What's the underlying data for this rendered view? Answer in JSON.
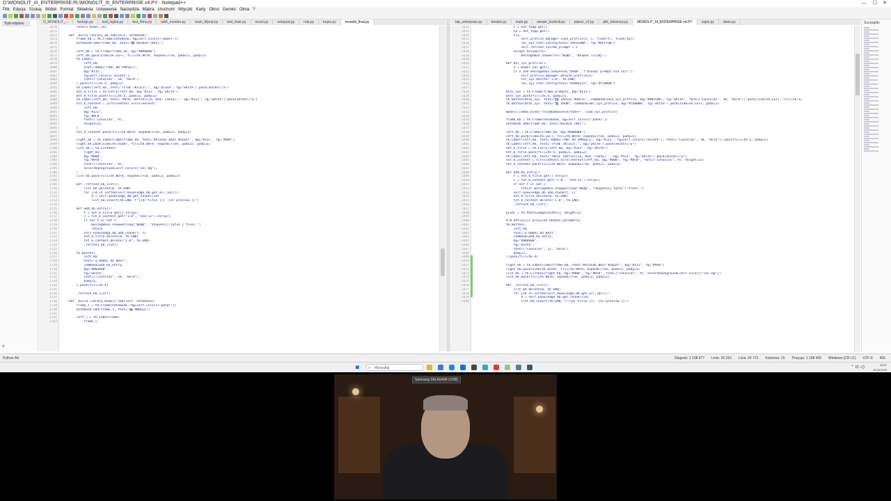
{
  "window": {
    "title": "D:\\MONOLIT_III_ENTERPRISE.PL\\MONOLIT_III_ENTERPRISE.v4.PY - Notepad++",
    "minimize": "—",
    "maximize": "☐",
    "close": "✕"
  },
  "menu": [
    "Plik",
    "Edycja",
    "Szukaj",
    "Widok",
    "Format",
    "Składnia",
    "Ustawienia",
    "Narzędzia",
    "Makra",
    "Uruchom",
    "Wtyczki",
    "Karty",
    "Okno",
    "Gemini",
    "Okna",
    "?"
  ],
  "left_tabs": [
    "D_MONOLIT_...",
    "funkcje.py",
    "kod_logika.py",
    "test_filmu.py",
    "tab5_monitor.py",
    "main_Mysql.py",
    "test_brak.py",
    "monit.py",
    "notepad.py",
    "rola.py",
    "kopia.py",
    "monolit_final.py"
  ],
  "right_tabs": [
    "tab_enterprise.py",
    "kreator.py",
    "main.py",
    "serwer_kontroli.py",
    "planer_v2.py",
    "plik_tekstowy.py",
    "MONOLIT_III_ENTERPRISE.v4.PY",
    "zapis.py",
    "dane.py"
  ],
  "left_panel": {
    "tab": "Tryb edytora",
    "gear": "⚙"
  },
  "right_panel": {
    "title": "Szczegóły"
  },
  "left_gutter_start": 2670,
  "right_gutter_start": 2412,
  "left_code": [
    "        return model_var",
    "",
    "    def _build_library_kb_tab(self, notebook):",
    "        frame_kb = tk.Frame(notebook, bg=self.colors[\"panel\"])",
    "        notebook.add(frame_kb, text=\"📚 WIEDZA (KAZ)\")",
    "",
    "        left_kb = tk.Frame(frame_kb, bg=\"#000000\")",
    "        left_kb.pack(side=tk.LEFT, fill=tk.BOTH, expand=True, padx=5, pady=5)",
    "        tk.Label(",
    "            left_kb,",
    "            text=\"DODAJ FAKT DO PAMIĘCI\",",
    "            bg=\"#111\",",
    "            fg=self.colors[\"accent\"],",
    "            font=(\"Consolas\", 10, \"bold\"),",
    "        ).pack(fill=tk.X, pady=5)",
    "        tk.Label(left_kb, text=\"TYTUŁ (Klucz):\", bg=\"black\", fg=\"white\").pack(anchor=\"w\")",
    "        ent_k_title = tk.Entry(left_kb, bg=\"#333\", fg=\"white\")",
    "        ent_k_title.pack(fill=tk.X, padx=5, pady=2)",
    "        tk.Label(left_kb, text=\"TREŚĆ (Definicja, Kod, Fakty):\", bg=\"#111\", fg=\"white\").pack(anchor=\"w\")",
    "        txt_k_content = scrolledtext.ScrolledText(",
    "            left_kb,",
    "            bg=\"#222\",",
    "            fg=\"#0F0\",",
    "            font=(\"Consolas\", 9),",
    "            height=15,",
    "        )",
    "        txt_k_content.pack(fill=tk.BOTH, expand=True, padx=5, pady=2)",
    "",
    "        right_kb = tk.LabelFrame(frame_kb, text=\"KATALOG BAZY WIEDZY\", bg=\"#111\", fg=\"#AAA\")",
    "        right_kb.pack(side=tk.RIGHT, fill=tk.BOTH, expand=True, padx=5, pady=5)",
    "        list_kb = tk.Listbox(",
    "            right_kb,",
    "            bg=\"#000\",",
    "            fg=\"#0f0\",",
    "            font=(\"Consolas\", 9),",
    "            selectbackground=self.colors[\"sel_bg\"],",
    "        )",
    "        list_kb.pack(fill=tk.BOTH, expand=True, padx=2, pady=2)",
    "",
    "        def _refresh_kb_list():",
    "            list_kb.delete(0, tk.END)",
    "            for cid in sorted(self.knowledge_db.get_all_ids()):",
    "                d = self.knowledge_db.get_chunk(cid)",
    "                list_kb.insert(tk.END, f\"[{d['title']}] :{d['preview']}\")",
    "",
    "        def add_kb_entry():",
    "            t = ent_k_title.get().strip()",
    "            c = txt_k_content.get(\"1.0\", \"end-1c\").strip()",
    "            if not t or not c:",
    "                messagebox.showwarning(\"BŁĄD\", \"Uzupełnij tytuł i treść.\")",
    "                return",
    "            self.knowledge_db.add_chunk(t, c)",
    "            ent_k_title.delete(0, tk.END)",
    "            txt_k_content.delete(\"1.0\", tk.END)",
    "            _refresh_kb_list()",
    "",
    "        tk.Button(",
    "            left_kb,",
    "            text=\"✚ DODAJ DO BAZY\",",
    "            command=add_kb_entry,",
    "            bg=\"#004400\",",
    "            fg=\"white\",",
    "            font=(\"Consolas\", 10, \"bold\"),",
    "            pady=5,",
    "        ).pack(fill=tk.X)",
    "",
    "        _refresh_kb_list()",
    "",
    "    def _build_library_models_tab(self, notebook):",
    "        frame_l = tk.Frame(notebook, bg=self.colors[\"panel\"])",
    "        notebook.add(frame_l, text=\"📦 MODELE\")",
    "",
    "        left_l = tk.LabelFrame(",
    "            frame_l,"
  ],
  "right_code": [
    "        t = ent_temp.get()",
    "        tp = ent_topp.get()",
    "        try:",
    "            self.profile_manager.save_profile(n, s, float(t), float(tp))",
    "            lbl_sys_stat.config(text=\"ZAPISANO\", fg=\"#0FFF00\")",
    "            self.refresh_system_prompt = s",
    "        except ValueError:",
    "            messagebox.showerror(\"BŁĄD\", \"Błędne liczby\")",
    "",
    "    def del_sys_profile():",
    "        n = model_var.get()",
    "        if n and messagebox.askyesno(\"USUŃ\", f\"Usunąć prompt dla {n}?\"):",
    "            self.profile_manager.delete_profile(n)",
    "            txt_sys.delete(\"1.0\", tk.END)",
    "            lbl_sys_stat.config(text=\"USUNIĘTO\", fg=\"#FF0000\")",
    "",
    "    btns_sys = tk.Frame(frame_prompts, bg=\"#111\")",
    "    btns_sys.pack(fill=tk.X, pady=5)",
    "    tk.Button(btns_sys, text=\"💾 ZAPISZ PROFIL\", command=save_sys_profile, bg=\"#005500\", fg=\"white\", font=(\"Consolas\", 10, \"bold\")).pack(side=tk.LEFT, fill=tk.X)",
    "    tk.Button(btns_sys, text=\"🗑 USUŃ\", command=del_sys_profile, bg=\"#550000\", fg=\"white\").pack(side=tk.LEFT, padx=2)",
    "",
    "    models_combo.bind(\"<<ComboboxSelected>>\", load_sys_profile)",
    "",
    "    frame_kb = tk.Frame(notebook, bg=self.colors[\"panel\"])",
    "    notebook.add(frame_kb, text=\"WIEDZA (KB)\")",
    "",
    "    left_kb = tk.Frame(frame_kb, bg=\"#000000\")",
    "    left_kb.pack(side=tk.LEFT, fill=tk.BOTH, expand=True, padx=5, pady=5)",
    "    tk.Label(left_kb, text=\"DODAJ FAKT DO PAMIĘCI\", bg=\"#111\", fg=self.colors[\"accent\"], font=(\"Consolas\", 10, \"bold\")).pack(fill=tk.X, pady=5)",
    "    tk.Label(left_kb, text=\"TYTUŁ (Klucz):\", bg=\"white\").pack(anchor=\"w\")",
    "    ent_k_title = tk.Entry(left_kb, bg=\"#333\", fg=\"white\")",
    "    ent_k_title.pack(fill=tk.X, padx=5, pady=2)",
    "    tk.Label(left_kb, text=\"TREŚĆ (Definicja, Kod, Fakty):\", bg=\"#111\", fg=\"white\").pack(anchor=\"w\")",
    "    txt_k_content = scrolledtext.ScrolledText(left_kb, bg=\"#000\", fg=\"#0F0\", font=(\"Consolas\", 9), height=15)",
    "    txt_k_content.pack(fill=tk.BOTH, expand=True, padx=5, pady=2)",
    "",
    "    def add_kb_entry():",
    "        t = ent_k_title.get().strip()",
    "        c = txt_k_content.get(\"1.0\", \"end-1c\").strip()",
    "        if not t or not c:",
    "            return messagebox.showwarning(\"BŁĄD\", \"Uzupełnij tytuł i treść.\")",
    "        self.knowledge_db.add_chunk(t, c)",
    "        ent_k_title.delete(0, tk.END)",
    "        txt_k_content.delete(\"1.0\", tk.END)",
    "        _refresh_kb_list()",
    "",
    "    pixel = tk.PhotoImage(width=1, height=1)",
    "",
    "    # W definicji przycisk dodano parametry:",
    "    tk.Button(",
    "        left_kb,",
    "        text=\"✚ DODAJ DO BAZY\",",
    "        command=add_kb_entry,",
    "        bg=\"#006600\",",
    "        fg=\"white\",",
    "        font=(\"Consolas\", 11, \"bold\"),",
    "        pady=5,",
    "    ).pack(fill=tk.X)",
    "",
    "    right_kb = tk.LabelFrame(frame_kb, text=\"KATALOG BAZY WIEDZY\", bg=\"#111\", fg=\"#AAA\")",
    "    right_kb.pack(side=tk.RIGHT, fill=tk.BOTH, expand=True, padx=5, pady=5)",
    "    list_kb = tk.Listbox(right_kb, bg=\"#000\", fg=\"#0f0\", font=(\"Consolas\", 9), selectbackground=self.colors[\"sel_bg\"])",
    "    list_kb.pack(fill=tk.BOTH, expand=True, padx=2, pady=2)",
    "",
    "    def _refresh_kb_list():",
    "        list_kb.delete(0, tk.END)",
    "        for cid in sorted(self.knowledge_db.get_all_ids()):",
    "            d = self.knowledge_db.get_chunk(cid)",
    "            list_kb.insert(tk.END, f\"[{d['title']}] :{d['preview']}\")"
  ],
  "status": {
    "left": "Python file",
    "length": "Długość: 1 108 877",
    "lines": "Linie: 26 316",
    "position": "Linia: 24 772",
    "column": "Kolumna: 15",
    "pos": "Pozycja: 1 108 409",
    "eol": "Windows (CR LF)",
    "encoding": "UTF-8",
    "mode": "INS"
  },
  "taskbar": {
    "search_placeholder": "Wyszukaj",
    "time": "19:57",
    "date": "14.03.2025"
  },
  "webcam": {
    "label": "Samsung SM-A546B (USB)"
  },
  "colors": {
    "accent": "#1a73e8",
    "code_blue": "#1a1a8a",
    "string_gray": "#777777"
  }
}
